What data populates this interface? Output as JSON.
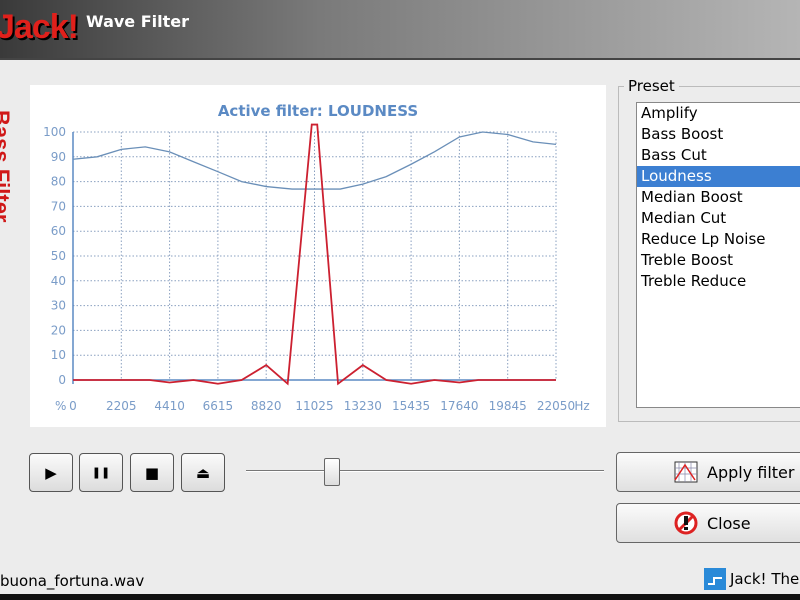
{
  "window": {
    "logo": "Jack!",
    "title": "Wave Filter",
    "side_brand": "Bass Filter"
  },
  "chart_data": {
    "type": "line",
    "title": "Active filter: LOUDNESS",
    "ylabel": "%",
    "xlabel": "Hz",
    "xlim": [
      0,
      22050
    ],
    "ylim": [
      0,
      100
    ],
    "x_ticks": [
      "0",
      "2205",
      "4410",
      "6615",
      "8820",
      "11025",
      "13230",
      "15435",
      "17640",
      "19845",
      "22050"
    ],
    "y_ticks": [
      "0",
      "10",
      "20",
      "30",
      "40",
      "50",
      "60",
      "70",
      "80",
      "90",
      "100"
    ],
    "grid": true,
    "series": [
      {
        "color": "#6a8fb8",
        "points": [
          [
            0,
            89
          ],
          [
            1100,
            90
          ],
          [
            2205,
            93
          ],
          [
            3300,
            94
          ],
          [
            4410,
            92
          ],
          [
            5500,
            88
          ],
          [
            6615,
            84
          ],
          [
            7700,
            80
          ],
          [
            8820,
            78
          ],
          [
            10000,
            77
          ],
          [
            11025,
            77
          ],
          [
            12200,
            77
          ],
          [
            13230,
            79
          ],
          [
            14300,
            82
          ],
          [
            15435,
            87
          ],
          [
            16500,
            92
          ],
          [
            17640,
            98
          ],
          [
            18700,
            100
          ],
          [
            19845,
            99
          ],
          [
            21000,
            96
          ],
          [
            22050,
            95
          ]
        ]
      },
      {
        "color": "#cc2030",
        "points": [
          [
            0,
            0
          ],
          [
            3500,
            0
          ],
          [
            4410,
            -1
          ],
          [
            5500,
            0
          ],
          [
            6615,
            -1.5
          ],
          [
            7700,
            0
          ],
          [
            8820,
            6
          ],
          [
            9800,
            -1.5
          ],
          [
            10900,
            103
          ],
          [
            11150,
            103
          ],
          [
            12100,
            -1.5
          ],
          [
            13230,
            6
          ],
          [
            14300,
            0
          ],
          [
            15435,
            -1.5
          ],
          [
            16500,
            0
          ],
          [
            17640,
            -1
          ],
          [
            18500,
            0
          ],
          [
            22050,
            0
          ]
        ]
      }
    ]
  },
  "preset": {
    "label": "Preset",
    "items": [
      "Amplify",
      "Bass Boost",
      "Bass Cut",
      "Loudness",
      "Median Boost",
      "Median Cut",
      "Reduce Lp Noise",
      "Treble Boost",
      "Treble Reduce"
    ],
    "selected": 3
  },
  "transport": {
    "play": "▶",
    "pause": "❚❚",
    "stop": "■",
    "eject": "⏏",
    "position_percent": 24
  },
  "buttons": {
    "apply": "Apply filter",
    "close": "Close"
  },
  "status": {
    "file": "buona_fortuna.wav",
    "brand": "Jack! The"
  }
}
